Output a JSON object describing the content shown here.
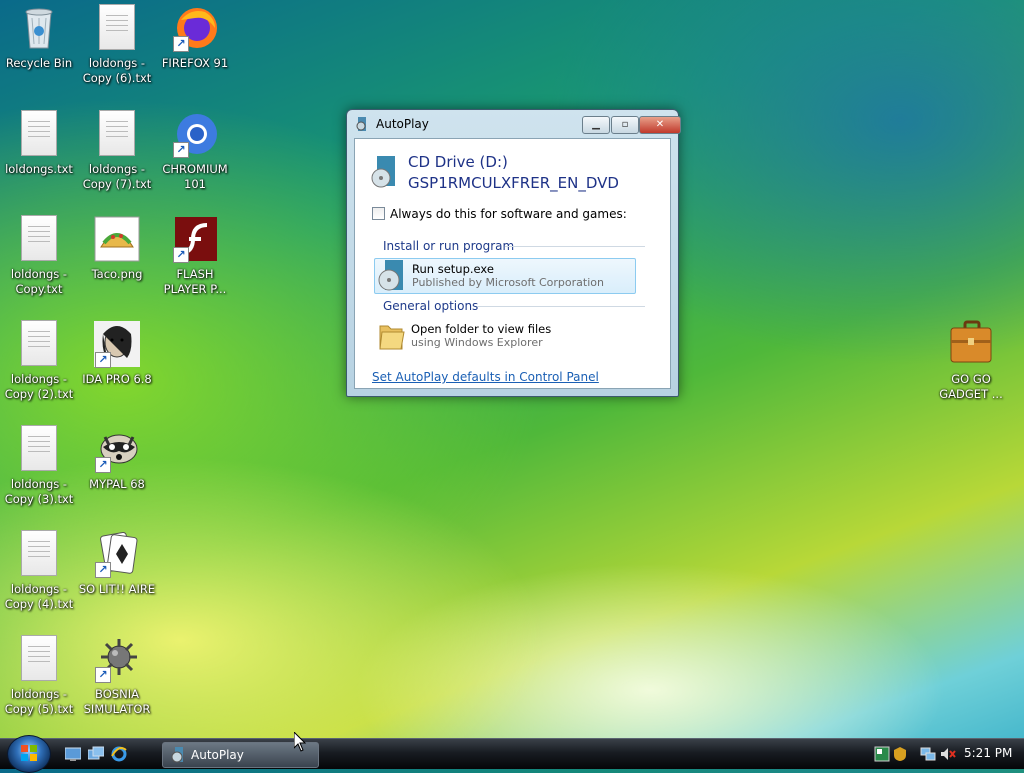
{
  "desktop": {
    "icons": [
      {
        "label": "Recycle Bin",
        "type": "recycle-bin"
      },
      {
        "label": "loldongs - Copy (6).txt",
        "type": "text-file"
      },
      {
        "label": "FIREFOX 91",
        "type": "firefox"
      },
      {
        "label": "loldongs.txt",
        "type": "text-file"
      },
      {
        "label": "loldongs - Copy (7).txt",
        "type": "text-file"
      },
      {
        "label": "CHROMIUM 101",
        "type": "chromium"
      },
      {
        "label": "loldongs - Copy.txt",
        "type": "text-file"
      },
      {
        "label": "Taco.png",
        "type": "image"
      },
      {
        "label": "FLASH PLAYER P...",
        "type": "flash"
      },
      {
        "label": "loldongs - Copy (2).txt",
        "type": "text-file"
      },
      {
        "label": "IDA PRO 6.8",
        "type": "ida"
      },
      {
        "label": "loldongs - Copy (3).txt",
        "type": "text-file"
      },
      {
        "label": "MYPAL 68",
        "type": "mypal"
      },
      {
        "label": "loldongs - Copy (4).txt",
        "type": "text-file"
      },
      {
        "label": "SO LIT!! AIRE",
        "type": "solitaire"
      },
      {
        "label": "loldongs - Copy (5).txt",
        "type": "text-file"
      },
      {
        "label": "BOSNIA SIMULATOR",
        "type": "bosnia"
      },
      {
        "label": "GO GO GADGET ...",
        "type": "gadget"
      }
    ]
  },
  "window": {
    "title": "AutoPlay",
    "drive_name": "CD Drive (D:)",
    "drive_label": "GSP1RMCULXFRER_EN_DVD",
    "always_checkbox": "Always do this for software and games:",
    "section_install": "Install or run program",
    "option_run": {
      "main": "Run setup.exe",
      "sub": "Published by Microsoft Corporation"
    },
    "section_general": "General options",
    "option_folder": {
      "main": "Open folder to view files",
      "sub": "using Windows Explorer"
    },
    "link": "Set AutoPlay defaults in Control Panel"
  },
  "taskbar": {
    "active_task": "AutoPlay",
    "clock": "5:21 PM"
  },
  "colors": {
    "accent": "#1e3287",
    "link": "#1a5fb4",
    "highlight": "#d9eefb"
  }
}
